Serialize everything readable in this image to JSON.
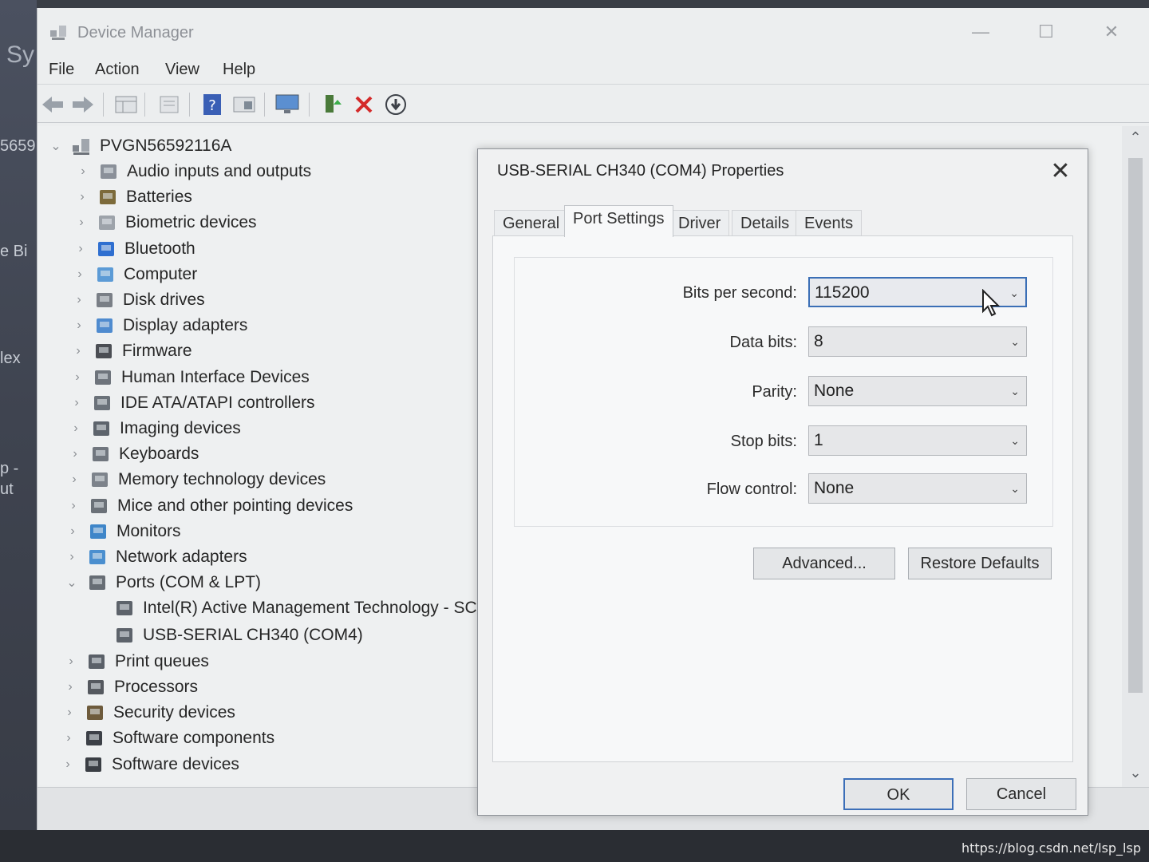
{
  "desktop": {
    "left_labels": [
      "Sy",
      "5659.",
      "e Bi",
      "lex",
      "p -",
      "ut"
    ],
    "watermark": "https://blog.csdn.net/lsp_lsp"
  },
  "device_manager": {
    "title": "Device Manager",
    "menu": [
      "File",
      "Action",
      "View",
      "Help"
    ],
    "toolbar_icons": [
      "back-arrow-icon",
      "forward-arrow-icon",
      "properties-grid-icon",
      "update-driver-icon",
      "help-icon",
      "view-icon",
      "monitor-icon",
      "add-driver-icon",
      "uninstall-x-icon",
      "download-icon"
    ],
    "tree": {
      "root": "PVGN56592116A",
      "items": [
        {
          "label": "Audio inputs and outputs",
          "icon": "speaker-icon"
        },
        {
          "label": "Batteries",
          "icon": "battery-icon"
        },
        {
          "label": "Biometric devices",
          "icon": "fingerprint-icon"
        },
        {
          "label": "Bluetooth",
          "icon": "bluetooth-icon"
        },
        {
          "label": "Computer",
          "icon": "computer-icon"
        },
        {
          "label": "Disk drives",
          "icon": "disk-icon"
        },
        {
          "label": "Display adapters",
          "icon": "display-icon"
        },
        {
          "label": "Firmware",
          "icon": "firmware-icon"
        },
        {
          "label": "Human Interface Devices",
          "icon": "hid-icon"
        },
        {
          "label": "IDE ATA/ATAPI controllers",
          "icon": "ide-icon"
        },
        {
          "label": "Imaging devices",
          "icon": "camera-icon"
        },
        {
          "label": "Keyboards",
          "icon": "keyboard-icon"
        },
        {
          "label": "Memory technology devices",
          "icon": "memory-icon"
        },
        {
          "label": "Mice and other pointing devices",
          "icon": "mouse-icon"
        },
        {
          "label": "Monitors",
          "icon": "monitor-icon"
        },
        {
          "label": "Network adapters",
          "icon": "network-icon"
        },
        {
          "label": "Ports (COM & LPT)",
          "icon": "port-icon"
        },
        {
          "label": "Print queues",
          "icon": "printer-icon"
        },
        {
          "label": "Processors",
          "icon": "cpu-icon"
        },
        {
          "label": "Security devices",
          "icon": "security-icon"
        },
        {
          "label": "Software components",
          "icon": "software-component-icon"
        },
        {
          "label": "Software devices",
          "icon": "software-device-icon"
        }
      ],
      "ports_children": [
        {
          "label": "Intel(R) Active Management Technology - SC",
          "icon": "port-icon"
        },
        {
          "label": "USB-SERIAL CH340 (COM4)",
          "icon": "port-icon"
        }
      ]
    }
  },
  "dialog": {
    "title": "USB-SERIAL CH340 (COM4) Properties",
    "close": "✕",
    "tabs": [
      "General",
      "Port Settings",
      "Driver",
      "Details",
      "Events"
    ],
    "active_tab": "Port Settings",
    "fields": [
      {
        "label": "Bits per second:",
        "value": "115200"
      },
      {
        "label": "Data bits:",
        "value": "8"
      },
      {
        "label": "Parity:",
        "value": "None"
      },
      {
        "label": "Stop bits:",
        "value": "1"
      },
      {
        "label": "Flow control:",
        "value": "None"
      }
    ],
    "buttons": {
      "advanced": "Advanced...",
      "restore": "Restore Defaults",
      "ok": "OK",
      "cancel": "Cancel"
    }
  },
  "colors": {
    "accent_focus": "#3b6fb6",
    "uninstall_red": "#d42a2a",
    "tree_icon_blue": "#3a7bd5"
  }
}
